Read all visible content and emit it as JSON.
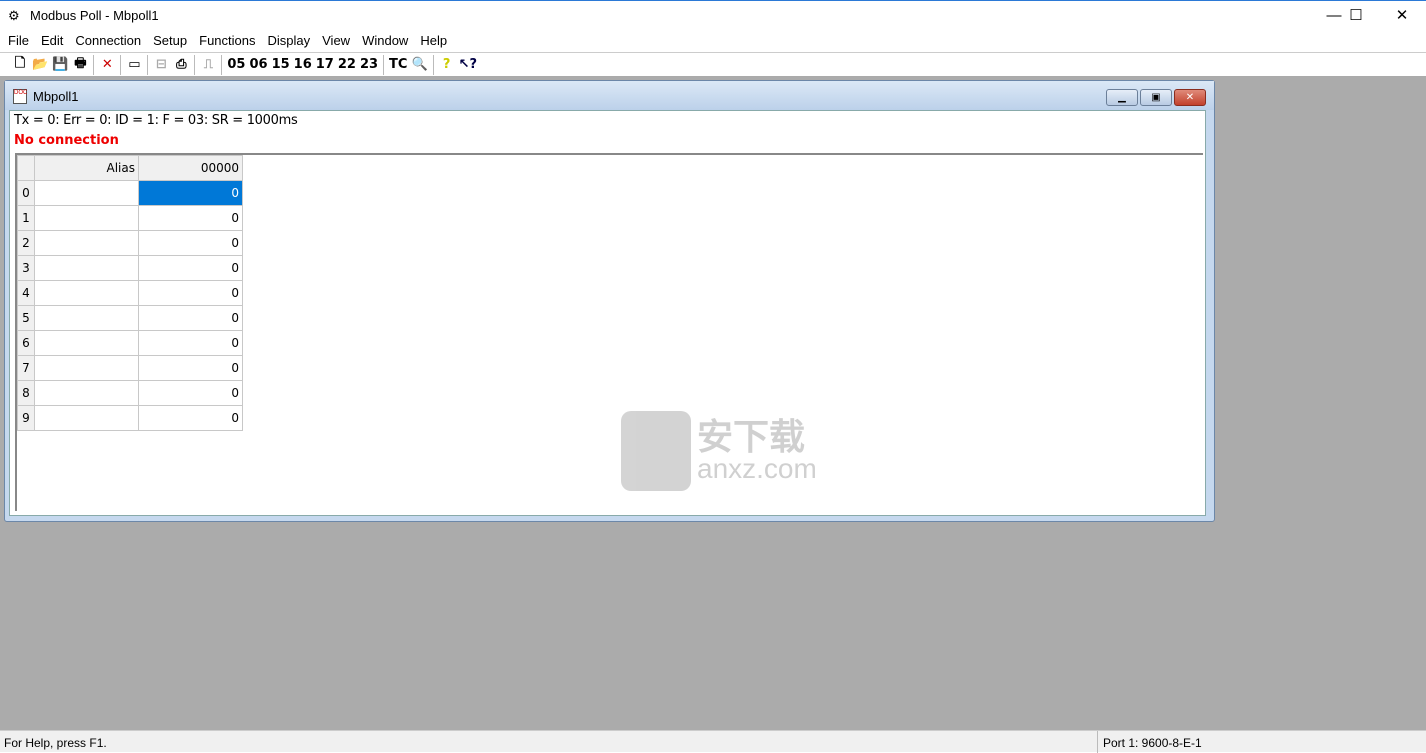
{
  "window": {
    "title": "Modbus Poll - Mbpoll1",
    "controls": [
      "—",
      "☐",
      "✕"
    ]
  },
  "menu": [
    "File",
    "Edit",
    "Connection",
    "Setup",
    "Functions",
    "Display",
    "View",
    "Window",
    "Help"
  ],
  "toolbar": {
    "function_codes": [
      "05",
      "06",
      "15",
      "16",
      "17",
      "22",
      "23"
    ],
    "tc_label": "TC"
  },
  "child": {
    "title": "Mbpoll1",
    "status_line": "Tx = 0: Err = 0: ID = 1: F = 03: SR = 1000ms",
    "connection_status": "No connection",
    "status_color": "#e00000",
    "columns": {
      "alias": "Alias",
      "address": "00000"
    },
    "rows": [
      {
        "index": "0",
        "alias": "",
        "value": "0"
      },
      {
        "index": "1",
        "alias": "",
        "value": "0"
      },
      {
        "index": "2",
        "alias": "",
        "value": "0"
      },
      {
        "index": "3",
        "alias": "",
        "value": "0"
      },
      {
        "index": "4",
        "alias": "",
        "value": "0"
      },
      {
        "index": "5",
        "alias": "",
        "value": "0"
      },
      {
        "index": "6",
        "alias": "",
        "value": "0"
      },
      {
        "index": "7",
        "alias": "",
        "value": "0"
      },
      {
        "index": "8",
        "alias": "",
        "value": "0"
      },
      {
        "index": "9",
        "alias": "",
        "value": "0"
      }
    ],
    "selected_color": "#0078d7"
  },
  "watermark": {
    "text": "安下载",
    "subtext": "anxz.com"
  },
  "statusbar": {
    "help": "For Help, press F1.",
    "port": "Port 1: 9600-8-E-1"
  }
}
